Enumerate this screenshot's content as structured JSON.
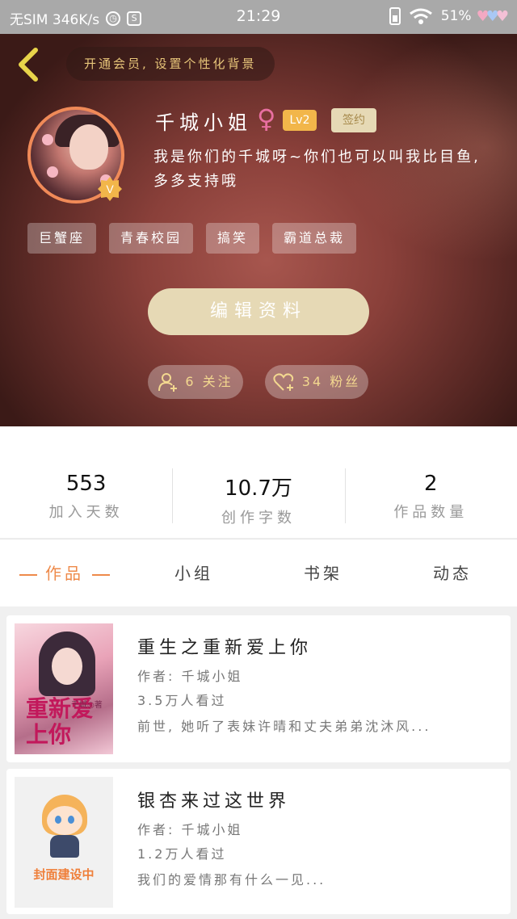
{
  "status_bar": {
    "carrier": "无SIM 346K/s",
    "time": "21:29",
    "battery": "51%"
  },
  "header": {
    "vip_promo": "开通会员, 设置个性化背景",
    "name": "千城小姐",
    "gender_symbol": "♀",
    "level": "Lv2",
    "signed": "签约",
    "bio": "我是你们的千城呀~你们也可以叫我比目鱼, 多多支持哦",
    "tags": [
      "巨蟹座",
      "青春校园",
      "搞笑",
      "霸道总裁"
    ],
    "edit_label": "编辑资料",
    "following": "6 关注",
    "fans": "34 粉丝"
  },
  "stats": [
    {
      "value": "553",
      "label": "加入天数"
    },
    {
      "value": "10.7万",
      "label": "创作字数"
    },
    {
      "value": "2",
      "label": "作品数量"
    }
  ],
  "tabs": [
    "作品",
    "小组",
    "书架",
    "动态"
  ],
  "books": [
    {
      "title": "重生之重新爱上你",
      "author": "作者: 千城小姐",
      "views": "3.5万人看过",
      "desc": "前世, 她听了表妹许晴和丈夫弟弟沈沐风...",
      "cover_text": "重新爱上你",
      "cover_author": "千城◎著"
    },
    {
      "title": "银杏来过这世界",
      "author": "作者: 千城小姐",
      "views": "1.2万人看过",
      "desc": "我们的爱情那有什么一见...",
      "cover_text": "封面建设中"
    }
  ],
  "colors": {
    "accent": "#ee8a4a",
    "level_badge": "#f2b64a",
    "button_beige": "#e6d9b5",
    "header_brown": "#8a403a"
  }
}
